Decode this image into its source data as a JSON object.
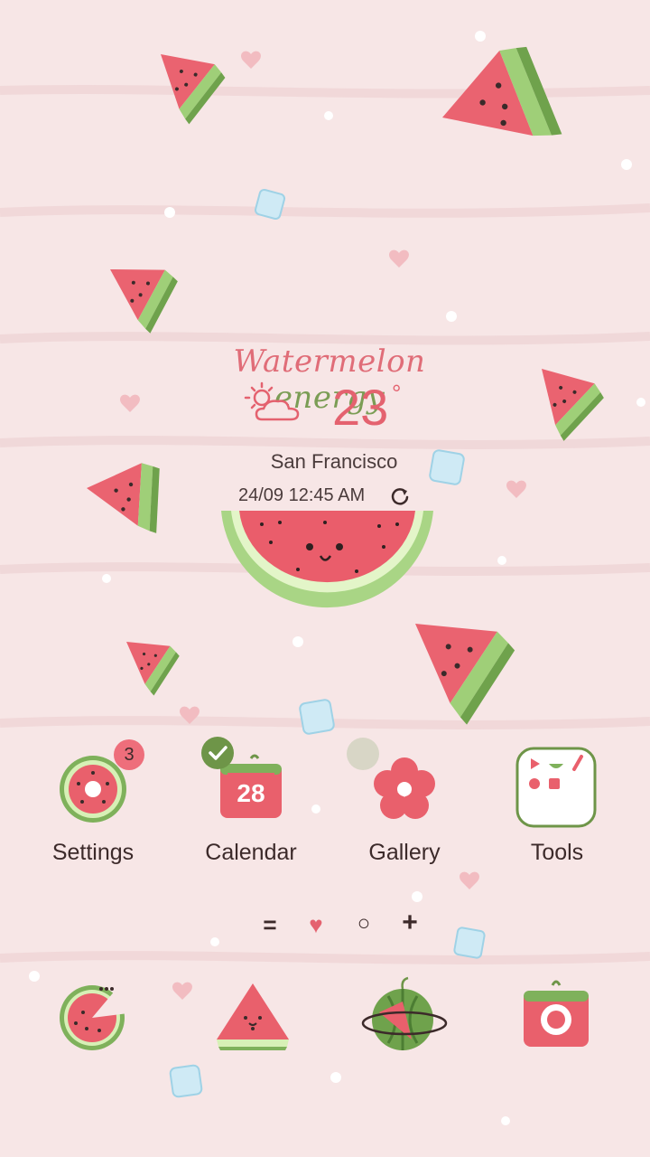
{
  "widget": {
    "tagline_part1": "Watermelon",
    "tagline_part2": "energy",
    "weather_icon": "partly-sunny-icon",
    "temperature": "23",
    "degree_symbol": "°",
    "city": "San Francisco",
    "datetime": "24/09 12:45 AM",
    "refresh_icon": "refresh-icon"
  },
  "apps": [
    {
      "label": "Settings",
      "icon": "watermelon-slice-gear-icon",
      "badge": "3"
    },
    {
      "label": "Calendar",
      "icon": "calendar-icon",
      "date": "28",
      "check_badge": "check-icon"
    },
    {
      "label": "Gallery",
      "icon": "flower-icon"
    },
    {
      "label": "Tools",
      "icon": "tools-folder-icon"
    }
  ],
  "page_indicators": [
    {
      "icon": "menu-equals-icon",
      "glyph": "="
    },
    {
      "icon": "heart-icon",
      "glyph": "♥"
    },
    {
      "icon": "circle-icon",
      "glyph": "○"
    },
    {
      "icon": "plus-icon",
      "glyph": "+"
    }
  ],
  "dock": [
    {
      "icon": "phone-watermelon-icon"
    },
    {
      "icon": "messages-watermelon-icon"
    },
    {
      "icon": "internet-watermelon-planet-icon"
    },
    {
      "icon": "camera-watermelon-icon"
    }
  ],
  "colors": {
    "background": "#f7e6e6",
    "melon_red": "#e9606c",
    "rind_green": "#7fb15b",
    "rind_light": "#d7f0b6",
    "text_dark": "#3c2a2a",
    "accent_green": "#6e9548"
  }
}
